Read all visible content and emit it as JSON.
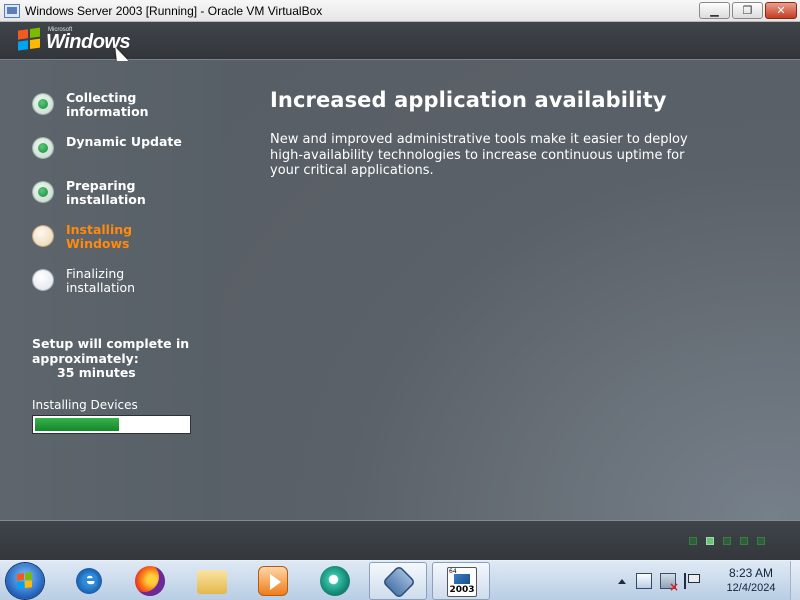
{
  "window": {
    "title": "Windows Server 2003 [Running] - Oracle VM VirtualBox",
    "minimize": "▁",
    "restore": "❐",
    "close": "✕"
  },
  "setup": {
    "logo_microsoft": "Microsoft",
    "logo_windows": "Windows",
    "steps": [
      {
        "label": "Collecting information",
        "state": "done"
      },
      {
        "label": "Dynamic Update",
        "state": "done"
      },
      {
        "label": "Preparing installation",
        "state": "done"
      },
      {
        "label": "Installing Windows",
        "state": "active"
      },
      {
        "label": "Finalizing installation",
        "state": "pending"
      }
    ],
    "eta_line1": "Setup will complete in",
    "eta_line2": "approximately:",
    "eta_minutes": "35 minutes",
    "progress_label": "Installing Devices",
    "progress_fraction": 0.55,
    "headline": "Increased application availability",
    "description": "New and improved administrative tools make it easier to deploy high-availability technologies to increase continuous uptime for your critical applications.",
    "slide_dots": {
      "count": 5,
      "active_index": 1
    }
  },
  "taskbar": {
    "apps": [
      {
        "name": "internet-explorer"
      },
      {
        "name": "firefox"
      },
      {
        "name": "file-explorer"
      },
      {
        "name": "media-player"
      },
      {
        "name": "app"
      },
      {
        "name": "virtualbox"
      },
      {
        "name": "windows-server-2003-vm",
        "badge_top": "64",
        "badge_label": "2003"
      }
    ],
    "clock_time": "8:23 AM",
    "clock_date": "12/4/2024"
  },
  "colors": {
    "active_step": "#ff8a0d",
    "progress_green": "#14862c",
    "setup_bg": "#5b6168"
  }
}
